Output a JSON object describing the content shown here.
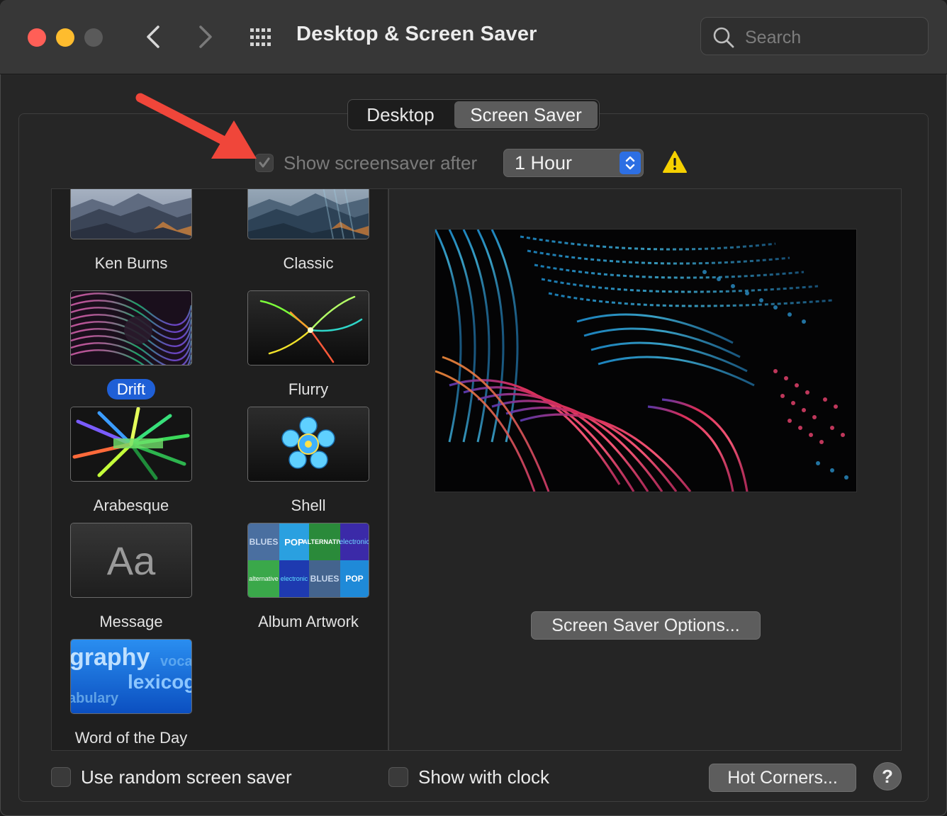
{
  "window": {
    "title": "Desktop & Screen Saver",
    "search_placeholder": "Search"
  },
  "tabs": [
    {
      "label": "Desktop",
      "active": false
    },
    {
      "label": "Screen Saver",
      "active": true
    }
  ],
  "idle": {
    "checkbox_label": "Show screensaver after",
    "checked": true,
    "enabled": false,
    "time_value": "1 Hour"
  },
  "savers": [
    {
      "name": "Ken Burns",
      "icon": "mountain-landscape-thumbnail"
    },
    {
      "name": "Classic",
      "icon": "mountain-landscape-thumbnail"
    },
    {
      "name": "Drift",
      "icon": "drift-swirl-thumbnail",
      "selected": true
    },
    {
      "name": "Flurry",
      "icon": "flurry-thumbnail"
    },
    {
      "name": "Arabesque",
      "icon": "arabesque-thumbnail"
    },
    {
      "name": "Shell",
      "icon": "shell-thumbnail"
    },
    {
      "name": "Message",
      "icon": "message-thumbnail",
      "glyph": "Aa"
    },
    {
      "name": "Album Artwork",
      "icon": "album-artwork-thumbnail"
    },
    {
      "name": "Word of the Day",
      "icon": "word-of-the-day-thumbnail"
    }
  ],
  "album_art": {
    "tiles": [
      "BLUES",
      "POP",
      "ALTERNATIVE",
      "electronic",
      "electronic",
      "BLUES",
      "POP",
      "alternative"
    ]
  },
  "word_thumb": {
    "words": [
      "graphy",
      "voca",
      "lexicog",
      "abulary"
    ]
  },
  "preview": {
    "options_button": "Screen Saver Options..."
  },
  "footer": {
    "random_label": "Use random screen saver",
    "random_checked": false,
    "clock_label": "Show with clock",
    "clock_checked": false,
    "hot_corners_button": "Hot Corners...",
    "help_glyph": "?"
  },
  "colors": {
    "accent": "#1f5fd6",
    "arrow": "#f0463a",
    "warning": "#f5d000"
  }
}
